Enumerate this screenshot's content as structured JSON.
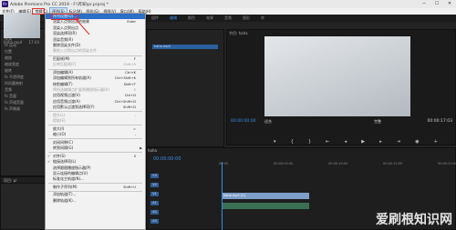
{
  "window": {
    "title": "Adobe Premiere Pro CC 2019 - F:\\咋知\\pr.prproj *",
    "app_icon_text": "Pr"
  },
  "menubar": {
    "items": [
      "文件(F)",
      "编辑(E)",
      "剪辑(C)",
      "序列(S)",
      "标记(M)",
      "图形(G)",
      "视图(V)",
      "窗口(W)",
      "帮助(H)"
    ],
    "active_index": 3
  },
  "workspace_tabs": [
    "组件",
    "编辑",
    "颜色",
    "效果",
    "音频",
    "图形",
    "库"
  ],
  "workspace_selected": 1,
  "left_panel": {
    "header": "效果控件",
    "rows": [
      "源: *hahah.mp4",
      "视频",
      "fx 运动",
      "位置",
      "缩放",
      "缩放宽度",
      "旋转",
      "fx 不透明度",
      "时间重映射",
      "音频",
      "fx 音量",
      "fx 声道音量",
      "fx 声像器"
    ]
  },
  "project_panel": {
    "header": "项目: pr",
    "clip_name": "haha.mp4",
    "clip_duration": "17:03"
  },
  "source_clip": "haha.mp4",
  "program_monitor": {
    "header": "节目: haha",
    "timecode_left": "00:00:00:00",
    "fit": "适合",
    "quality": "完整",
    "timecode_right": "00:00:17:03"
  },
  "timeline": {
    "tab": "haha",
    "timecode": "00:00:00:00",
    "ruler": [
      "00:00",
      "00:00:05:00",
      "00:00:10:00",
      "00:00:15:00",
      "00:00:20:00"
    ],
    "tracks": [
      "V3",
      "V2",
      "V1",
      "A1",
      "A2",
      "A3"
    ],
    "video_clip_label": "haha.mp4 [V]"
  },
  "sequence_menu": {
    "items": [
      {
        "label": "序列设置(Q)...",
        "shortcut": "",
        "state": "highlight"
      },
      {
        "label": "渲染入点到出点的效果",
        "shortcut": "Enter",
        "state": "normal"
      },
      {
        "label": "渲染入点到出点",
        "shortcut": "",
        "state": "normal"
      },
      {
        "label": "渲染选择项(R)",
        "shortcut": "",
        "state": "normal"
      },
      {
        "label": "渲染音频(R)",
        "shortcut": "",
        "state": "normal"
      },
      {
        "label": "删除渲染文件(D)",
        "shortcut": "",
        "state": "normal"
      },
      {
        "label": "删除入点到出点的渲染文件",
        "shortcut": "",
        "state": "disabled"
      },
      {
        "sep": true
      },
      {
        "label": "匹配帧(M)",
        "shortcut": "F",
        "state": "normal"
      },
      {
        "label": "反转匹配帧(F)",
        "shortcut": "Shift+R",
        "state": "disabled"
      },
      {
        "sep": true
      },
      {
        "label": "添加编辑(A)",
        "shortcut": "Ctrl+K",
        "state": "normal"
      },
      {
        "label": "添加编辑到所有轨道(A)",
        "shortcut": "Ctrl+Shift+K",
        "state": "normal"
      },
      {
        "label": "修剪编辑(T)",
        "shortcut": "Shift+T",
        "state": "normal"
      },
      {
        "label": "将所选编辑点扩展到播放指示器(X)",
        "shortcut": "E",
        "state": "disabled"
      },
      {
        "label": "应用视频过渡(V)",
        "shortcut": "Ctrl+D",
        "state": "normal"
      },
      {
        "label": "应用音频过渡(A)",
        "shortcut": "Ctrl+Shift+D",
        "state": "normal"
      },
      {
        "label": "应用默认过渡到选择项(Y)",
        "shortcut": "Shift+D",
        "state": "normal"
      },
      {
        "sep": true
      },
      {
        "label": "提升(L)",
        "shortcut": ";",
        "state": "disabled"
      },
      {
        "label": "提取(E)",
        "shortcut": "'",
        "state": "disabled"
      },
      {
        "sep": true
      },
      {
        "label": "放大(I)",
        "shortcut": "=",
        "state": "normal"
      },
      {
        "label": "缩小(O)",
        "shortcut": "-",
        "state": "normal"
      },
      {
        "sep": true
      },
      {
        "label": "封闭间隙(C)",
        "shortcut": "",
        "state": "normal"
      },
      {
        "label": "转到间隔(G)",
        "shortcut": "",
        "state": "normal",
        "submenu": true
      },
      {
        "sep": true
      },
      {
        "label": "对齐(S)",
        "shortcut": "S",
        "state": "checked"
      },
      {
        "label": "链接选择项(L)",
        "shortcut": "",
        "state": "checked"
      },
      {
        "label": "选择跟随播放指示器(P)",
        "shortcut": "",
        "state": "normal"
      },
      {
        "label": "显示连接的编辑点(U)",
        "shortcut": "",
        "state": "normal"
      },
      {
        "label": "标准化主轨道(N)...",
        "shortcut": "",
        "state": "normal"
      },
      {
        "sep": true
      },
      {
        "label": "制作子序列(M)",
        "shortcut": "Shift+U",
        "state": "normal"
      },
      {
        "sep": true
      },
      {
        "label": "添加轨道(T)...",
        "shortcut": "",
        "state": "normal"
      },
      {
        "label": "删除轨道(K)...",
        "shortcut": "",
        "state": "normal"
      }
    ]
  },
  "annotation_color": "#e23030",
  "watermark": "爱刷根知识网"
}
